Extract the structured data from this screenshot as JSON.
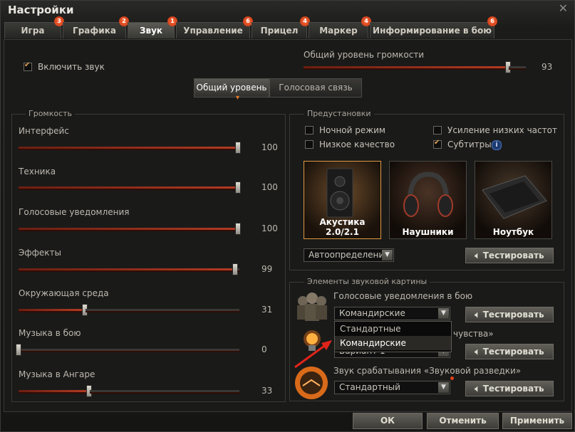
{
  "window": {
    "title": "Настройки"
  },
  "tabs": [
    {
      "label": "Игра",
      "badge": "3"
    },
    {
      "label": "Графика",
      "badge": "2"
    },
    {
      "label": "Звук",
      "badge": "1"
    },
    {
      "label": "Управление",
      "badge": "6"
    },
    {
      "label": "Прицел",
      "badge": "4"
    },
    {
      "label": "Маркер",
      "badge": "4"
    },
    {
      "label": "Информирование в бою",
      "badge": "6"
    }
  ],
  "sound": {
    "enable_label": "Включить звук",
    "master_label": "Общий уровень громкости",
    "master_value": "93",
    "master_level": 93
  },
  "switch": {
    "general": "Общий уровень",
    "voice": "Голосовая связь"
  },
  "volume": {
    "title": "Громкость",
    "sliders": [
      {
        "label": "Интерфейс",
        "value": "100",
        "level": 100
      },
      {
        "label": "Техника",
        "value": "100",
        "level": 100
      },
      {
        "label": "Голосовые уведомления",
        "value": "100",
        "level": 100
      },
      {
        "label": "Эффекты",
        "value": "99",
        "level": 99
      },
      {
        "label": "Окружающая среда",
        "value": "31",
        "level": 31
      },
      {
        "label": "Музыка в бою",
        "value": "0",
        "level": 0
      },
      {
        "label": "Музыка в Ангаре",
        "value": "33",
        "level": 33
      }
    ]
  },
  "presets": {
    "title": "Предустановки",
    "night_mode": "Ночной режим",
    "low_quality": "Низкое качество",
    "bass_boost": "Усиление низких частот",
    "subtitles": "Субтитры",
    "info_icon": "i",
    "devices": [
      "Акустика 2.0/2.1",
      "Наушники",
      "Ноутбук"
    ],
    "autodetect": "Автоопределение",
    "test": "Тестировать"
  },
  "elements": {
    "title": "Элементы звуковой картины",
    "voice_label": "Голосовые уведомления в бою",
    "voice_value": "Командирские",
    "options": [
      "Стандартные",
      "Командирские"
    ],
    "sixth_sense_label_tail": "чувства»",
    "sixth_sense_value": "Вариант 1",
    "radar_label": "Звук срабатывания «Звуковой разведки»",
    "radar_value": "Стандартный",
    "test": "Тестировать"
  },
  "footer": {
    "ok": "ОК",
    "cancel": "Отменить",
    "apply": "Применить"
  }
}
